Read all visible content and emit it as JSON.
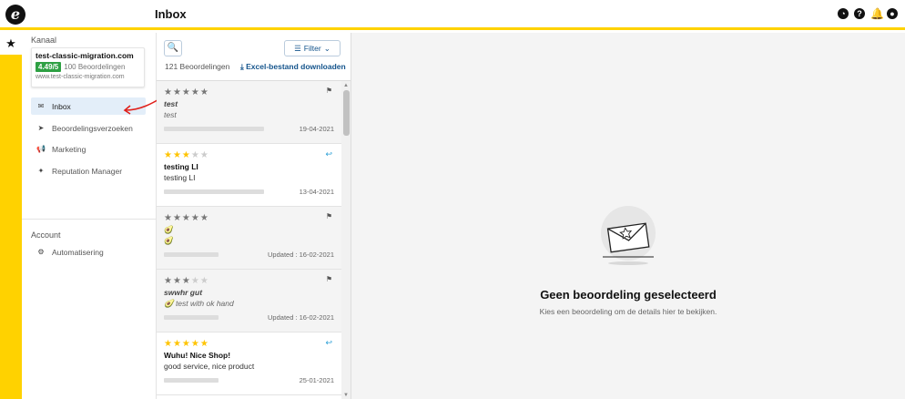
{
  "app": {
    "page_title": "Inbox",
    "logo_letter": "e"
  },
  "topbar": {
    "icons": [
      "gauge-icon",
      "help-icon",
      "bell-icon",
      "user-icon"
    ]
  },
  "rail": {
    "star": "★"
  },
  "sidebar": {
    "channel_label": "Kanaal",
    "channel": {
      "name": "test-classic-migration.com",
      "score": "4.49/5",
      "review_count": "100 Beoordelingen",
      "url": "www.test-classic-migration.com"
    },
    "items": [
      {
        "label": "Inbox",
        "icon": "inbox-icon",
        "glyph": "✉",
        "active": true
      },
      {
        "label": "Beoordelingsverzoeken",
        "icon": "send-icon",
        "glyph": "➤",
        "active": false
      },
      {
        "label": "Marketing",
        "icon": "megaphone-icon",
        "glyph": "📢",
        "active": false
      },
      {
        "label": "Reputation Manager",
        "icon": "sparkle-icon",
        "glyph": "✦",
        "active": false
      }
    ],
    "account_label": "Account",
    "account_items": [
      {
        "label": "Automatisering",
        "icon": "automation-icon",
        "glyph": "⚙"
      }
    ]
  },
  "list": {
    "filter_label": "Filter",
    "count_text": "121 Beoordelingen",
    "excel_link": "Excel-bestand downloaden",
    "reviews": [
      {
        "rating": 0,
        "grey": true,
        "title": "test",
        "body": "test",
        "italic": true,
        "date": "19-04-2021",
        "status_icon": "flag-icon"
      },
      {
        "rating": 3,
        "grey": false,
        "title": "testing LI",
        "body": "testing LI",
        "italic": false,
        "date": "13-04-2021",
        "status_icon": "reply-icon"
      },
      {
        "rating": 0,
        "grey": true,
        "title": "🥑",
        "body": "🥑",
        "italic": false,
        "date": "Updated : 16-02-2021",
        "status_icon": "flag-icon"
      },
      {
        "rating": 3,
        "grey": true,
        "title": "swwhr gut",
        "body": "🥑 test with ok hand",
        "italic": true,
        "date": "Updated : 16-02-2021",
        "status_icon": "flag-icon"
      },
      {
        "rating": 5,
        "grey": false,
        "title": "Wuhu! Nice Shop!",
        "body": "good service, nice product",
        "italic": false,
        "date": "25-01-2021",
        "status_icon": "reply-icon"
      }
    ]
  },
  "detail": {
    "empty_title": "Geen beoordeling geselecteerd",
    "empty_subtitle": "Kies een beoordeling om de details hier te bekijken."
  },
  "colors": {
    "brand_yellow": "#FFD200",
    "link_blue": "#14548c",
    "score_green": "#2ea043",
    "star_gold": "#FFC400",
    "reply_blue": "#2a9fd6"
  }
}
